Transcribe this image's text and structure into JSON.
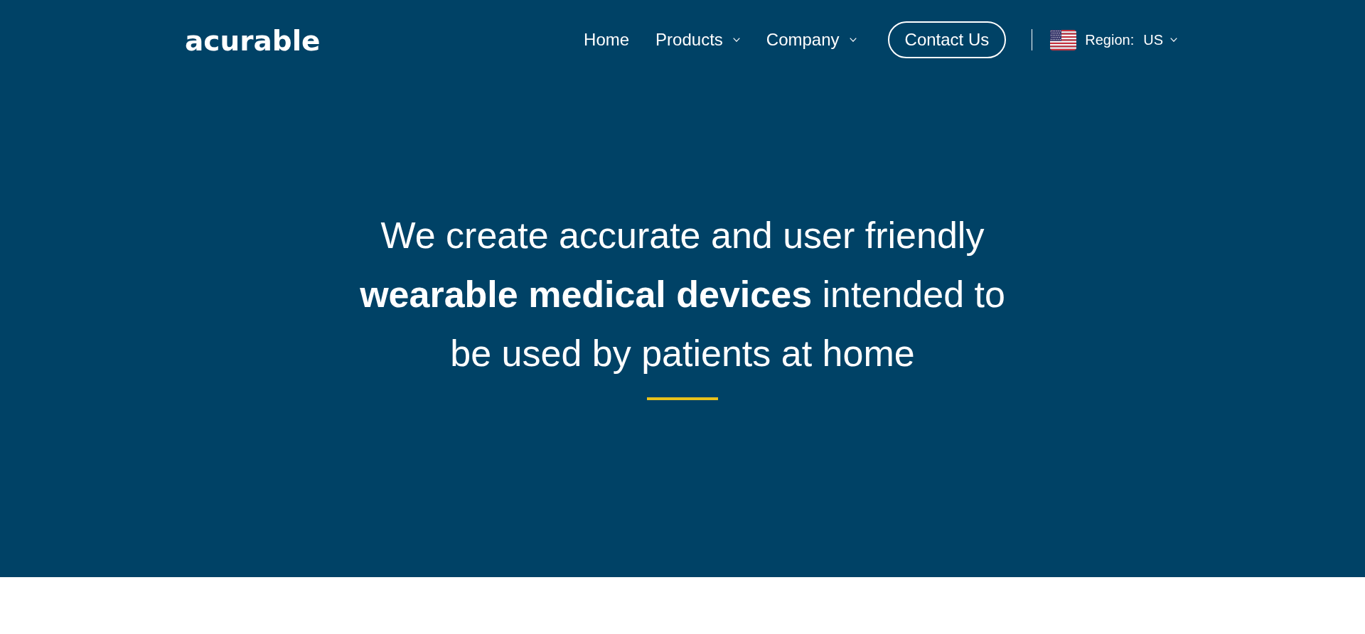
{
  "header": {
    "logo": "acurable",
    "nav": [
      {
        "label": "Home",
        "dropdown": false
      },
      {
        "label": "Products",
        "dropdown": true
      },
      {
        "label": "Company",
        "dropdown": true
      }
    ],
    "contact_button": "Contact Us",
    "region": {
      "label": "Region:",
      "value": "US",
      "dropdown": true
    }
  },
  "hero": {
    "headline": "We create accurate and user friendly **wearable medical devices** intended to be used by patients at home"
  }
}
